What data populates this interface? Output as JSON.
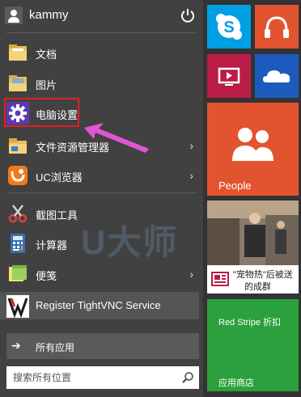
{
  "user": {
    "name": "kammy"
  },
  "menu": {
    "items": [
      {
        "label": "文档"
      },
      {
        "label": "图片"
      },
      {
        "label": "电脑设置"
      },
      {
        "label": "文件资源管理器"
      },
      {
        "label": "UC浏览器"
      },
      {
        "label": "截图工具"
      },
      {
        "label": "计算器"
      },
      {
        "label": "便笺"
      },
      {
        "label": "Register TightVNC Service"
      }
    ],
    "all_apps": "所有应用"
  },
  "search": {
    "placeholder": "搜索所有位置"
  },
  "tiles": {
    "people": "People",
    "news_headline": "\"宠物热\"后被送",
    "news_subline": "的成群",
    "red_stripe": "Red Stripe 折扣",
    "store": "应用商店"
  },
  "watermark": "U大师",
  "colors": {
    "skype": "#009fe3",
    "music": "#e2542f",
    "video": "#b91d47",
    "onedrive": "#1c5bbd",
    "people": "#e2542f",
    "news_bar": "#ffffff",
    "store": "#2ca03c",
    "highlight": "#e02020",
    "arrow": "#e055d8"
  }
}
